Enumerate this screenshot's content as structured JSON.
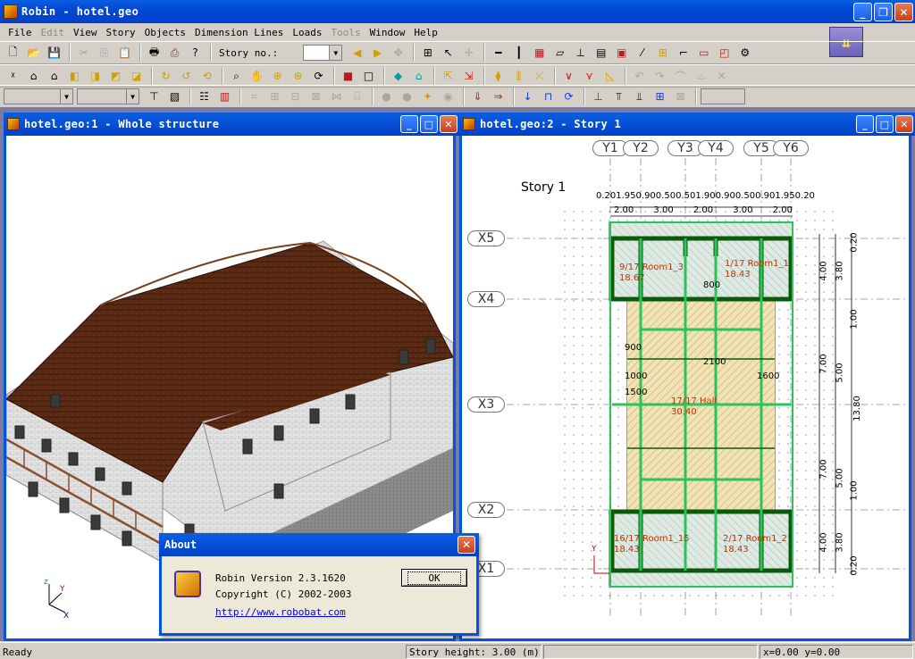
{
  "app": {
    "title": "Robin - hotel.geo",
    "window_buttons": [
      "_",
      "❐",
      "✕"
    ]
  },
  "menu": [
    {
      "label": "File",
      "enabled": true
    },
    {
      "label": "Edit",
      "enabled": false
    },
    {
      "label": "View",
      "enabled": true
    },
    {
      "label": "Story",
      "enabled": true
    },
    {
      "label": "Objects",
      "enabled": true
    },
    {
      "label": "Dimension Lines",
      "enabled": true
    },
    {
      "label": "Loads",
      "enabled": true
    },
    {
      "label": "Tools",
      "enabled": false
    },
    {
      "label": "Window",
      "enabled": true
    },
    {
      "label": "Help",
      "enabled": true
    }
  ],
  "toolbar": {
    "story_label": "Story no.:",
    "story_value": ""
  },
  "windows": {
    "left": {
      "title": "hotel.geo:1 - Whole structure"
    },
    "right": {
      "title": "hotel.geo:2 - Story 1"
    }
  },
  "plan": {
    "story_title": "Story 1",
    "y_axes": [
      "Y1",
      "Y2",
      "Y3",
      "Y4",
      "Y5",
      "Y6"
    ],
    "x_axes": [
      "X5",
      "X4",
      "X3",
      "X2",
      "X1"
    ],
    "top_dims_fine": [
      "0.20",
      "1.95",
      "0.90",
      "0.50",
      "0.50",
      "1.90",
      "0.90",
      "0.50",
      "0.90",
      "1.95",
      "0.20"
    ],
    "top_dims": [
      "2.00",
      "3.00",
      "2.00",
      "3.00",
      "2.00"
    ],
    "right_dims_a": [
      "4.00",
      "7.00",
      "7.00",
      "4.00"
    ],
    "right_dims_b": [
      "3.80",
      "5.00",
      "5.00",
      "3.80"
    ],
    "right_dims_c": [
      "0.20",
      "1.00",
      "1.00",
      "0.20"
    ],
    "right_dims_total": "13.80",
    "rooms": [
      {
        "label": "9/17 Room1_3",
        "area": "18.67"
      },
      {
        "label": "1/17 Room1_1",
        "area": "18.43"
      },
      {
        "label": "17/17 Hall",
        "area": "30.40"
      },
      {
        "label": "16/17 Room1_15",
        "area": "18.43"
      },
      {
        "label": "2/17 Room1_2",
        "area": "18.43"
      }
    ],
    "openings": [
      "800",
      "900",
      "2100",
      "1500",
      "1000",
      "1600"
    ],
    "colors": {
      "wall": "#0b5a0b",
      "beam": "#29c45a",
      "hatch": "#555555",
      "room_text": "#c83000",
      "slab": "#f3e3b0"
    }
  },
  "about": {
    "title": "About",
    "version": "Robin Version 2.3.1620",
    "copyright": "Copyright (C) 2002-2003",
    "link": "http://www.robobat.com",
    "ok": "OK"
  },
  "status": {
    "ready": "Ready",
    "story_height": "Story height: 3.00 (m)",
    "coords": "x=0.00 y=0.00"
  }
}
